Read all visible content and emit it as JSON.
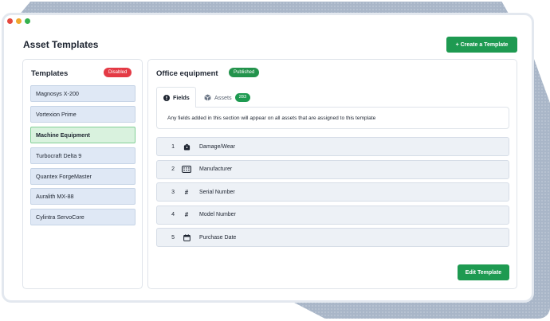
{
  "window": {
    "dot_colors": [
      "#e5493f",
      "#f0a92e",
      "#35b24e"
    ]
  },
  "header": {
    "title": "Asset Templates",
    "create_button": "+ Create a Template"
  },
  "templates_panel": {
    "heading": "Templates",
    "status_badge": "Disabled",
    "items": [
      {
        "label": "Magnosys X-200",
        "active": false
      },
      {
        "label": "Vortexion Prime",
        "active": false
      },
      {
        "label": "Machine Equipment",
        "active": true
      },
      {
        "label": "Turbocraft Delta 9",
        "active": false
      },
      {
        "label": "Quantex ForgeMaster",
        "active": false
      },
      {
        "label": "Auralith MX-88",
        "active": false
      },
      {
        "label": "Cylintra ServoCore",
        "active": false
      }
    ]
  },
  "detail_panel": {
    "title": "Office equipment",
    "status_badge": "Published",
    "tabs": {
      "fields": {
        "label": "Fields",
        "icon": "info-circle-icon"
      },
      "assets": {
        "label": "Assets",
        "count": "283",
        "icon": "cube-icon"
      }
    },
    "info_text": "Any fields added in this section will appear on all assets that are assigned to this template",
    "fields": [
      {
        "number": "1",
        "label": "Damage/Wear",
        "icon": "bag-icon"
      },
      {
        "number": "2",
        "label": "Manufacturer",
        "icon": "keyboard-icon"
      },
      {
        "number": "3",
        "label": "Serial Number",
        "icon": "hash-icon"
      },
      {
        "number": "4",
        "label": "Model Number",
        "icon": "hash-icon"
      },
      {
        "number": "5",
        "label": "Purchase Date",
        "icon": "calendar-icon"
      }
    ],
    "edit_button": "Edit Template"
  },
  "colors": {
    "accent_green": "#1e9a51",
    "danger_red": "#e43a45",
    "backdrop": "#a9b6c8"
  }
}
